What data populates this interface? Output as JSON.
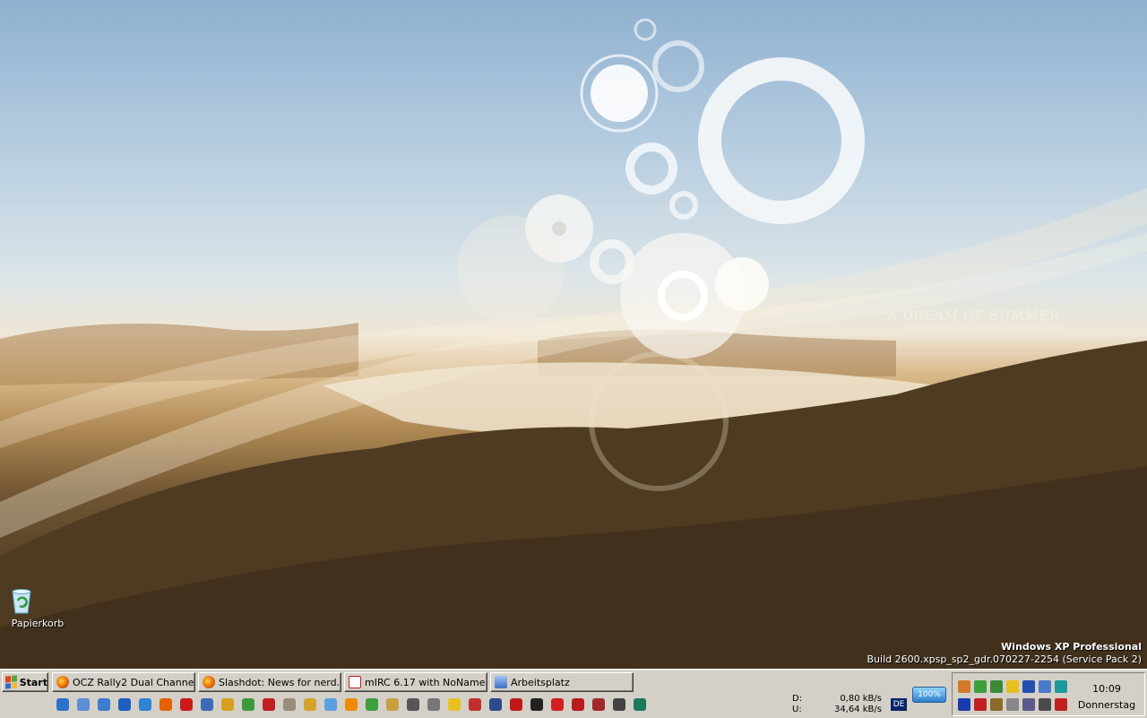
{
  "wallpaper": {
    "title": "A DREAM OF SUMMER",
    "subtitle": "HAPPENING AT MOVING-INSECT.COM"
  },
  "desktop": {
    "icons": [
      {
        "label": "Papierkorb",
        "icon": "recycle-bin-icon"
      }
    ],
    "watermark": {
      "line1": "Windows XP Professional",
      "line2": "Build 2600.xpsp_sp2_gdr.070227-2254 (Service Pack 2)"
    }
  },
  "taskbar": {
    "start_label": "Start",
    "tasks": [
      {
        "label": "OCZ Rally2 Dual Channel...",
        "icon": "firefox-icon",
        "color": "#e66000"
      },
      {
        "label": "Slashdot: News for nerd...",
        "icon": "firefox-icon",
        "color": "#e66000"
      },
      {
        "label": "mIRC 6.17 with NoName...",
        "icon": "mirc-icon",
        "color": "#c02020"
      },
      {
        "label": "Arbeitsplatz",
        "icon": "my-computer-icon",
        "color": "#3c6fc4"
      }
    ],
    "quick_launch": [
      {
        "icon": "internet-explorer-icon",
        "color": "#2a72c9"
      },
      {
        "icon": "system-icon",
        "color": "#5a8fd6"
      },
      {
        "icon": "network-icon",
        "color": "#3d7ccf"
      },
      {
        "icon": "fc-icon",
        "color": "#1c5fc0"
      },
      {
        "icon": "ie-icon",
        "color": "#2f84d6"
      },
      {
        "icon": "firefox-icon",
        "color": "#e66000"
      },
      {
        "icon": "opera-icon",
        "color": "#cc1b1b"
      },
      {
        "icon": "thunderbird-icon",
        "color": "#3b6cb5"
      },
      {
        "icon": "handshake-icon",
        "color": "#d8a020"
      },
      {
        "icon": "messenger-icon",
        "color": "#3a9a3a"
      },
      {
        "icon": "mirc-icon",
        "color": "#c02020"
      },
      {
        "icon": "winamp-icon",
        "color": "#9a8c7a"
      },
      {
        "icon": "ruler-icon",
        "color": "#d6a32a"
      },
      {
        "icon": "itunes-icon",
        "color": "#5aa0e0"
      },
      {
        "icon": "vlc-icon",
        "color": "#f08a00"
      },
      {
        "icon": "utorrent-icon",
        "color": "#3ca03c"
      },
      {
        "icon": "pen-icon",
        "color": "#c9a040"
      },
      {
        "icon": "tw-icon",
        "color": "#555555"
      },
      {
        "icon": "factory-icon",
        "color": "#777777"
      },
      {
        "icon": "pikachu-icon",
        "color": "#e8c020"
      },
      {
        "icon": "game-icon",
        "color": "#c03030"
      },
      {
        "icon": "media-icon",
        "color": "#2a4a8a"
      },
      {
        "icon": "pdf-icon",
        "color": "#c01818"
      },
      {
        "icon": "terminal-icon",
        "color": "#222222"
      },
      {
        "icon": "opera2-icon",
        "color": "#d02020"
      },
      {
        "icon": "filezilla-icon",
        "color": "#b81c1c"
      },
      {
        "icon": "rocket-icon",
        "color": "#a02a2a"
      },
      {
        "icon": "eye-icon",
        "color": "#444444"
      },
      {
        "icon": "n-icon",
        "color": "#1a7a5a"
      }
    ],
    "network": {
      "down_label": "D:",
      "down_value": "0,80 kB/s",
      "up_label": "U:",
      "up_value": "34,64 kB/s"
    },
    "language": "DE",
    "battery": "100%",
    "tray_icons": [
      {
        "icon": "user-icon",
        "color": "#d07a2a"
      },
      {
        "icon": "utorrent-tray-icon",
        "color": "#3ca03c"
      },
      {
        "icon": "battery-tray-icon",
        "color": "#3a8a3a"
      },
      {
        "icon": "flag-tray-icon",
        "color": "#e8c020"
      },
      {
        "icon": "cpu-1-00-ghz-icon",
        "color": "#2050b0"
      },
      {
        "icon": "network-disconnected-icon",
        "color": "#4a7ac8"
      },
      {
        "icon": "sync-icon",
        "color": "#1a9a9a"
      },
      {
        "icon": "antivirus-icon",
        "color": "#1a3ab0"
      },
      {
        "icon": "firewall-icon",
        "color": "#c02020"
      },
      {
        "icon": "ntlm-icon",
        "color": "#8a6a2a"
      },
      {
        "icon": "disk-icon",
        "color": "#888888"
      },
      {
        "icon": "volume-icon",
        "color": "#5a5a8a"
      },
      {
        "icon": "monitor-icon",
        "color": "#4a4a4a"
      },
      {
        "icon": "wifi-icon",
        "color": "#c02020"
      }
    ],
    "clock": {
      "time": "10:09",
      "day": "Donnerstag"
    }
  }
}
